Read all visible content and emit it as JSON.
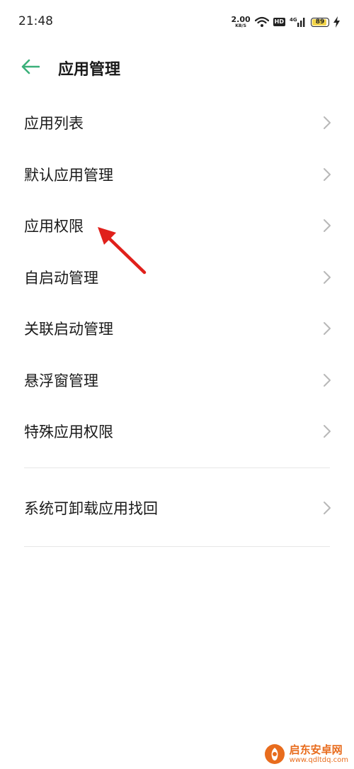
{
  "status_bar": {
    "time": "21:48",
    "net_speed_value": "2.00",
    "net_speed_unit": "KB/S",
    "hd_label": "HD",
    "network_type": "4G",
    "battery_level": "89",
    "icons": [
      "wifi-icon",
      "hd-icon",
      "signal-icon",
      "battery-icon",
      "charging-icon"
    ]
  },
  "header": {
    "title": "应用管理",
    "back_icon": "arrow-left-icon",
    "accent_color": "#3bb07a"
  },
  "menu": {
    "items": [
      {
        "label": "应用列表"
      },
      {
        "label": "默认应用管理"
      },
      {
        "label": "应用权限"
      },
      {
        "label": "自启动管理"
      },
      {
        "label": "关联启动管理"
      },
      {
        "label": "悬浮窗管理"
      },
      {
        "label": "特殊应用权限"
      }
    ],
    "secondary_items": [
      {
        "label": "系统可卸载应用找回"
      }
    ]
  },
  "annotation": {
    "arrow_color": "#e0201b"
  },
  "watermark": {
    "text": "启东安卓网",
    "url": "www.qdltdq.com"
  }
}
